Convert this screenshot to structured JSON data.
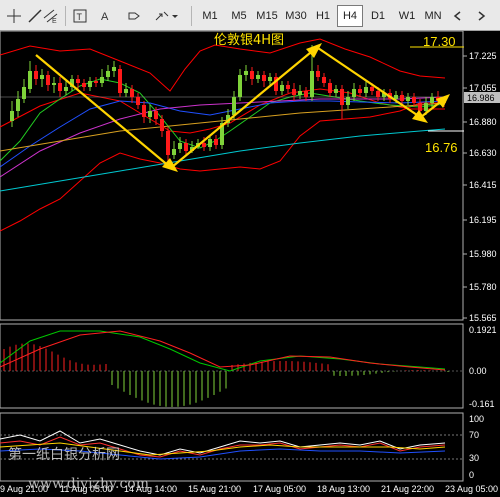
{
  "toolbar": {
    "timeframes": [
      "M1",
      "M5",
      "M15",
      "M30",
      "H1",
      "H4",
      "D1",
      "W1",
      "MN"
    ],
    "active_timeframe": "H4"
  },
  "chart": {
    "title": "伦敦银4H图",
    "annotation_high": "17.30",
    "annotation_low": "16.76",
    "current_price": "16.986",
    "price_labels": [
      "17.225",
      "17.055",
      "16.880",
      "16.630",
      "16.415",
      "16.195",
      "15.980",
      "15.780",
      "15.565"
    ],
    "x_labels": [
      "9 Aug 21:00",
      "11 Aug 05:00",
      "14 Aug 14:00",
      "15 Aug 21:00",
      "17 Aug 05:00",
      "18 Aug 13:00",
      "21 Aug 22:00",
      "23 Aug 05:00"
    ],
    "watermark": "第一纸白银分析网",
    "watermark_url": "www.diyizhy.com"
  },
  "macd_panel": {
    "labels": [
      "0.1921",
      "0.00",
      "-0.161"
    ]
  },
  "rsi_panel": {
    "labels": [
      "100",
      "70",
      "30",
      "0"
    ]
  },
  "colors": {
    "background": "#000000",
    "bull_candle": "#7fd33a",
    "bear_candle": "#ff1a1a",
    "trend_arrow": "#ffd400",
    "bollinger": "#ff0000",
    "annotation": "#ffe400",
    "current_price_bg": "#c0c0c0"
  }
}
